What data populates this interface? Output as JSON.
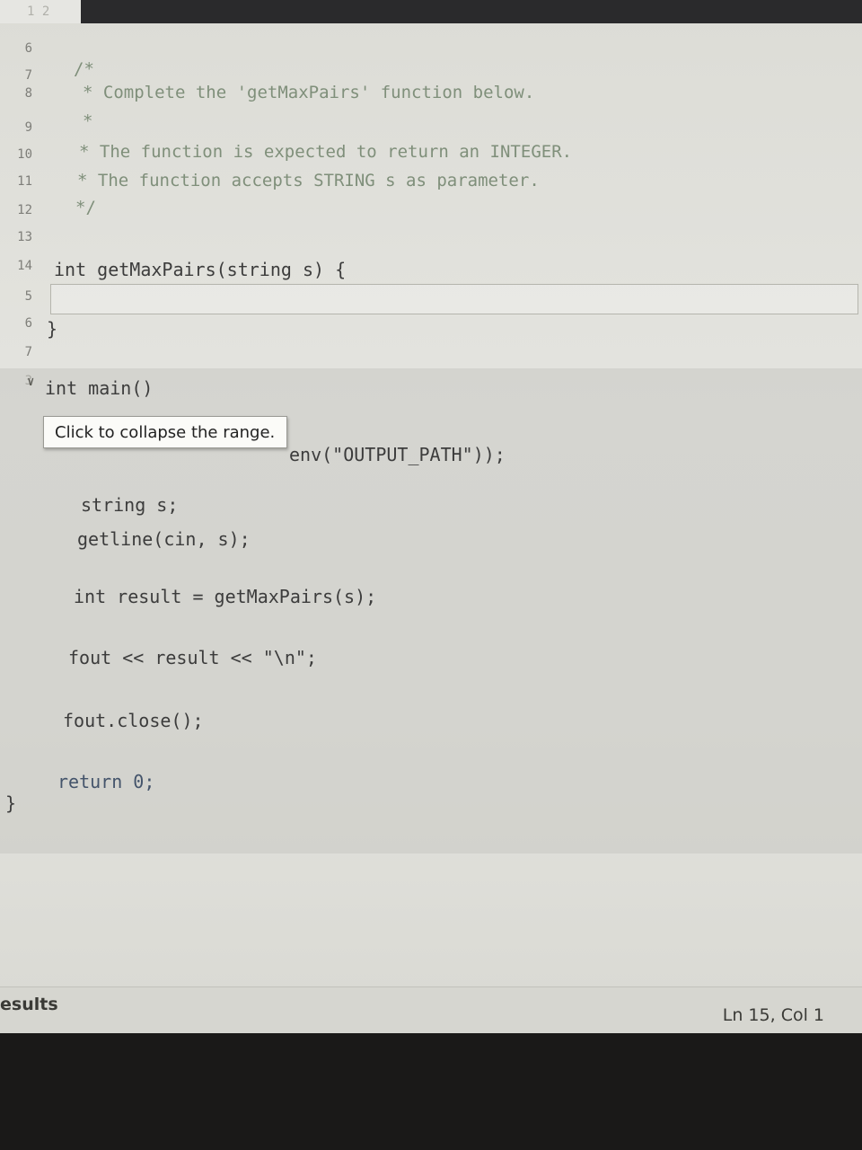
{
  "tab": {
    "label": "1 2"
  },
  "line_numbers": [
    "6",
    "7",
    "8",
    "9",
    "10",
    "11",
    "12",
    "13",
    "14",
    "5",
    "6",
    "7",
    "3"
  ],
  "code": {
    "comment_open": "/*",
    "comment_line1": "* Complete the 'getMaxPairs' function below.",
    "comment_star": "*",
    "comment_line2": "* The function is expected to return an INTEGER.",
    "comment_line3": "* The function accepts STRING s as parameter.",
    "comment_close": "*/",
    "func_sig": "int getMaxPairs(string s) {",
    "func_close": "}",
    "main_sig": "int main()",
    "ofstream_tail": "env(\"OUTPUT_PATH\"));",
    "decl_s": "string s;",
    "getline": "getline(cin, s);",
    "result": "int result = getMaxPairs(s);",
    "fout_out": "fout << result << \"\\n\";",
    "fout_close": "fout.close();",
    "ret": "return 0;",
    "main_close": "}"
  },
  "tooltip": {
    "text": "Click to collapse the range."
  },
  "status": {
    "results_label": "esults",
    "cursor_pos": "Ln 15, Col 1"
  }
}
